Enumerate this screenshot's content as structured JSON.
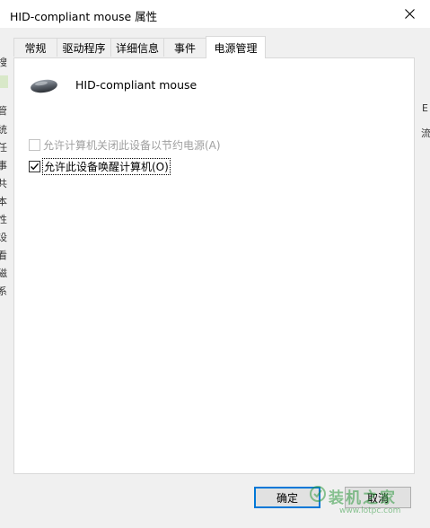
{
  "window": {
    "title": "HID-compliant mouse 属性",
    "close_icon": "close-icon"
  },
  "tabs": [
    {
      "label": "常规",
      "active": false
    },
    {
      "label": "驱动程序",
      "active": false
    },
    {
      "label": "详细信息",
      "active": false
    },
    {
      "label": "事件",
      "active": false
    },
    {
      "label": "电源管理",
      "active": true
    }
  ],
  "device": {
    "icon": "mouse-icon",
    "name": "HID-compliant mouse"
  },
  "options": [
    {
      "label": "允许计算机关闭此设备以节约电源(A)",
      "checked": false,
      "enabled": false
    },
    {
      "label": "允许此设备唤醒计算机(O)",
      "checked": true,
      "enabled": true
    }
  ],
  "buttons": {
    "ok": "确定",
    "cancel": "取消"
  },
  "background_window": {
    "left_chars": [
      "搜",
      "管",
      "统",
      "任",
      "事",
      "共",
      "本",
      "性",
      "设",
      "看",
      "磁",
      "系"
    ],
    "right_chars": [
      "E",
      "流"
    ]
  },
  "watermark": {
    "main": "装机之家",
    "url": "www.lotpc.com"
  },
  "colors": {
    "accent": "#0078d7",
    "disabled_text": "#a0a0a0",
    "panel": "#ffffff",
    "dialog_bg": "#f0f0f0"
  }
}
